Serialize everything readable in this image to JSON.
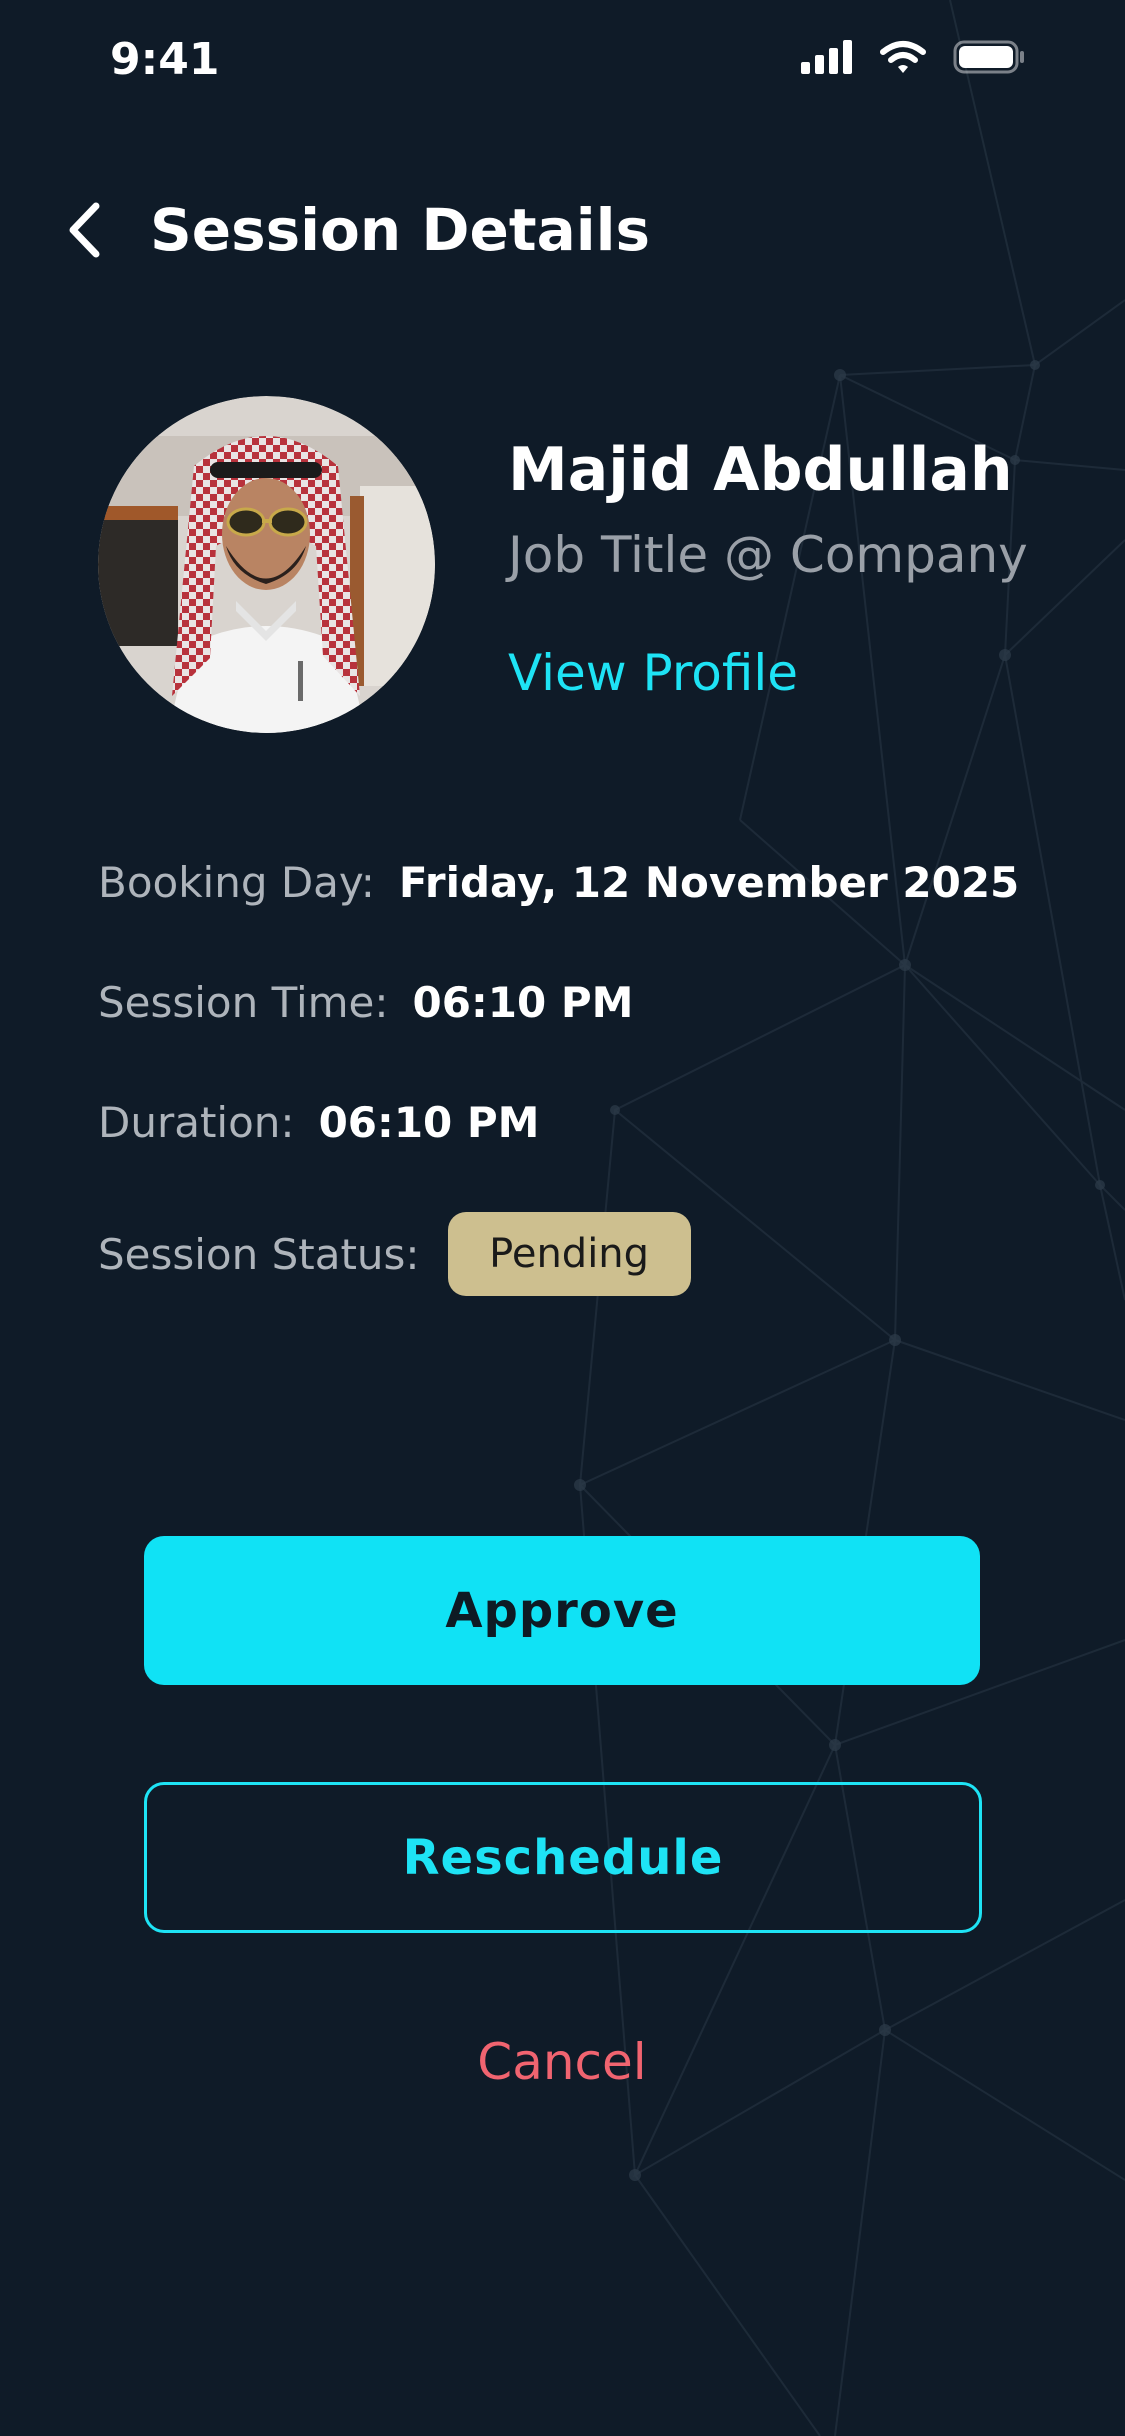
{
  "status_bar": {
    "time": "9:41"
  },
  "header": {
    "title": "Session Details"
  },
  "profile": {
    "name": "Majid Abdullah",
    "job": "Job Title @ Company",
    "view_profile_label": "View Profile"
  },
  "details": {
    "booking_day_label": "Booking Day:",
    "booking_day_value": "Friday, 12 November 2025",
    "session_time_label": "Session Time:",
    "session_time_value": "06:10 PM",
    "duration_label": "Duration:",
    "duration_value": "06:10 PM",
    "status_label": "Session Status:",
    "status_value": "Pending"
  },
  "actions": {
    "approve_label": "Approve",
    "reschedule_label": "Reschedule",
    "cancel_label": "Cancel"
  },
  "colors": {
    "background": "#0f1b28",
    "accent": "#10e2f5",
    "status_pending": "#cdbf8f",
    "cancel": "#f06470",
    "muted_text": "#9aa0a8"
  },
  "icons": {
    "back": "chevron-left-icon",
    "signal": "cellular-signal-icon",
    "wifi": "wifi-icon",
    "battery": "battery-icon"
  }
}
